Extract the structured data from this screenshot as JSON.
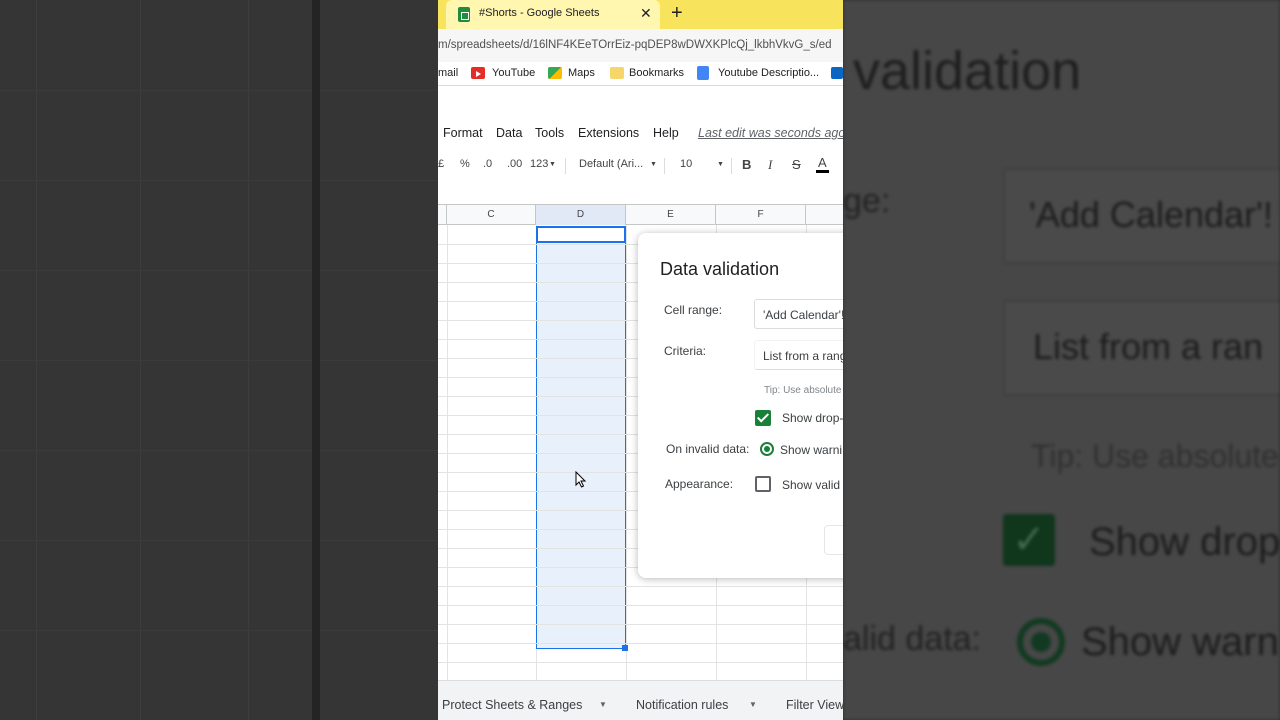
{
  "browser": {
    "tab_title": "#Shorts - Google Sheets",
    "new_tab": "+",
    "tab_close": "✕",
    "url": "m/spreadsheets/d/16lNF4KEeTOrrEiz-pqDEP8wDWXKPlcQj_lkbhVkvG_s/ed",
    "bookmarks": [
      {
        "label": "mail"
      },
      {
        "label": "YouTube"
      },
      {
        "label": "Maps"
      },
      {
        "label": "Bookmarks"
      },
      {
        "label": "Youtube Descriptio..."
      }
    ]
  },
  "menu": {
    "items": [
      "Format",
      "Data",
      "Tools",
      "Extensions",
      "Help"
    ],
    "last_edit": "Last edit was seconds ago"
  },
  "toolbar": {
    "currency": "£",
    "percent": "%",
    "dec_decrease": ".0",
    "dec_increase": ".00",
    "more_formats": "123",
    "font": "Default (Ari...",
    "font_size": "10",
    "bold": "B",
    "italic": "I",
    "strike": "S",
    "text_color": "A"
  },
  "grid": {
    "columns": [
      "C",
      "D",
      "E",
      "F"
    ]
  },
  "dialog": {
    "title": "Data validation",
    "cell_range_label": "Cell range:",
    "cell_range_value": "'Add Calendar'!",
    "criteria_label": "Criteria:",
    "criteria_value": "List from a range",
    "tip": "Tip: Use absolute",
    "show_dropdown": "Show drop-",
    "invalid_label": "On invalid data:",
    "invalid_option": "Show warni",
    "appearance_label": "Appearance:",
    "appearance_option": "Show valid"
  },
  "sheet_tabs": [
    "Protect Sheets & Ranges",
    "Notification rules",
    "Filter View"
  ],
  "background_zoom": {
    "title": "validation",
    "range_label": "ge:",
    "range_value": "'Add Calendar'!",
    "criteria_value": "List from a ran",
    "tip": "Tip: Use absolute",
    "show_dropdown": "Show drop-",
    "invalid_label": "alid data:",
    "invalid_option": "Show warni"
  },
  "colors": {
    "tab_bar": "#f8e45c",
    "selection": "#1a73e8",
    "sheets_green": "#188038"
  }
}
